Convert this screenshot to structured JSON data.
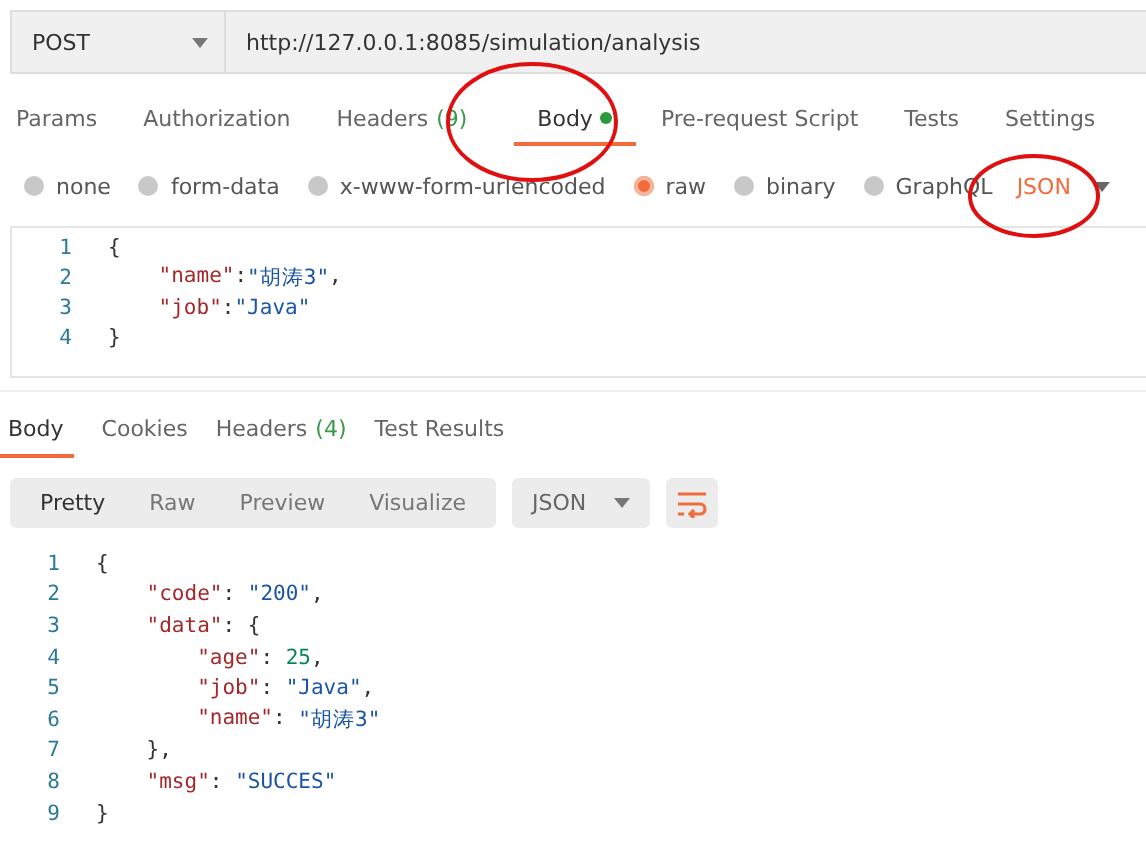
{
  "request": {
    "method": "POST",
    "url": "http://127.0.0.1:8085/simulation/analysis"
  },
  "request_tabs": [
    {
      "label": "Params",
      "selected": false
    },
    {
      "label": "Authorization",
      "selected": false
    },
    {
      "label": "Headers",
      "count": "(9)",
      "selected": false
    },
    {
      "label": "Body",
      "selected": true,
      "dot": true
    },
    {
      "label": "Pre-request Script",
      "selected": false
    },
    {
      "label": "Tests",
      "selected": false
    },
    {
      "label": "Settings",
      "selected": false
    }
  ],
  "body_types": [
    {
      "label": "none",
      "selected": false
    },
    {
      "label": "form-data",
      "selected": false
    },
    {
      "label": "x-www-form-urlencoded",
      "selected": false
    },
    {
      "label": "raw",
      "selected": true
    },
    {
      "label": "binary",
      "selected": false
    },
    {
      "label": "GraphQL",
      "selected": false
    }
  ],
  "body_language": "JSON",
  "request_body": {
    "lines": [
      {
        "number": "1",
        "tokens": [
          {
            "kind": "punct",
            "text": "{"
          }
        ]
      },
      {
        "number": "2",
        "tokens": [
          {
            "kind": "key",
            "text": "    \"name\""
          },
          {
            "kind": "punct",
            "text": ":"
          },
          {
            "kind": "string",
            "text": "\"胡涛3\""
          },
          {
            "kind": "punct",
            "text": ","
          }
        ]
      },
      {
        "number": "3",
        "tokens": [
          {
            "kind": "key",
            "text": "    \"job\""
          },
          {
            "kind": "punct",
            "text": ":"
          },
          {
            "kind": "string",
            "text": "\"Java\""
          }
        ]
      },
      {
        "number": "4",
        "tokens": [
          {
            "kind": "punct",
            "text": "}"
          }
        ]
      }
    ]
  },
  "response_tabs": [
    {
      "label": "Body",
      "selected": true
    },
    {
      "label": "Cookies",
      "selected": false
    },
    {
      "label": "Headers",
      "count": "(4)",
      "selected": false
    },
    {
      "label": "Test Results",
      "selected": false
    }
  ],
  "view_modes": [
    {
      "label": "Pretty",
      "selected": true
    },
    {
      "label": "Raw",
      "selected": false
    },
    {
      "label": "Preview",
      "selected": false
    },
    {
      "label": "Visualize",
      "selected": false
    }
  ],
  "response_format": "JSON",
  "response_body": {
    "lines": [
      {
        "number": "1",
        "tokens": [
          {
            "kind": "punct",
            "text": "{"
          }
        ]
      },
      {
        "number": "2",
        "tokens": [
          {
            "kind": "key",
            "text": "    \"code\""
          },
          {
            "kind": "punct",
            "text": ": "
          },
          {
            "kind": "string",
            "text": "\"200\""
          },
          {
            "kind": "punct",
            "text": ","
          }
        ]
      },
      {
        "number": "3",
        "tokens": [
          {
            "kind": "key",
            "text": "    \"data\""
          },
          {
            "kind": "punct",
            "text": ": {"
          }
        ]
      },
      {
        "number": "4",
        "tokens": [
          {
            "kind": "key",
            "text": "        \"age\""
          },
          {
            "kind": "punct",
            "text": ": "
          },
          {
            "kind": "number",
            "text": "25"
          },
          {
            "kind": "punct",
            "text": ","
          }
        ]
      },
      {
        "number": "5",
        "tokens": [
          {
            "kind": "key",
            "text": "        \"job\""
          },
          {
            "kind": "punct",
            "text": ": "
          },
          {
            "kind": "string",
            "text": "\"Java\""
          },
          {
            "kind": "punct",
            "text": ","
          }
        ]
      },
      {
        "number": "6",
        "tokens": [
          {
            "kind": "key",
            "text": "        \"name\""
          },
          {
            "kind": "punct",
            "text": ": "
          },
          {
            "kind": "string",
            "text": "\"胡涛3\""
          }
        ]
      },
      {
        "number": "7",
        "tokens": [
          {
            "kind": "punct",
            "text": "    },"
          }
        ]
      },
      {
        "number": "8",
        "tokens": [
          {
            "kind": "key",
            "text": "    \"msg\""
          },
          {
            "kind": "punct",
            "text": ": "
          },
          {
            "kind": "string",
            "text": "\"SUCCES\""
          }
        ]
      },
      {
        "number": "9",
        "tokens": [
          {
            "kind": "punct",
            "text": "}"
          }
        ]
      }
    ]
  }
}
